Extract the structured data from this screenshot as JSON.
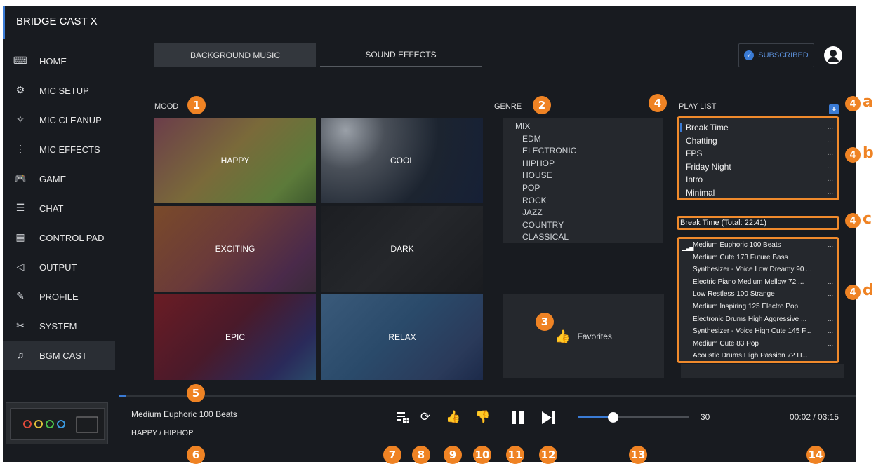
{
  "app": {
    "title": "BRIDGE CAST X"
  },
  "sidebar": {
    "items": [
      {
        "label": "HOME",
        "icon": "keyboard-icon",
        "glyph": "⌨"
      },
      {
        "label": "MIC SETUP",
        "icon": "mic-setup-icon",
        "glyph": "⚙"
      },
      {
        "label": "MIC CLEANUP",
        "icon": "mic-cleanup-icon",
        "glyph": "✧"
      },
      {
        "label": "MIC EFFECTS",
        "icon": "mic-effects-icon",
        "glyph": "⋮"
      },
      {
        "label": "GAME",
        "icon": "gamepad-icon",
        "glyph": "🎮"
      },
      {
        "label": "CHAT",
        "icon": "chat-icon",
        "glyph": "☰"
      },
      {
        "label": "CONTROL PAD",
        "icon": "grid-icon",
        "glyph": "▦"
      },
      {
        "label": "OUTPUT",
        "icon": "speaker-icon",
        "glyph": "◁"
      },
      {
        "label": "PROFILE",
        "icon": "profile-icon",
        "glyph": "✎"
      },
      {
        "label": "SYSTEM",
        "icon": "tools-icon",
        "glyph": "✂"
      },
      {
        "label": "BGM CAST",
        "icon": "music-note-icon",
        "glyph": "♫"
      }
    ]
  },
  "tabs": {
    "background_music": "BACKGROUND MUSIC",
    "sound_effects": "SOUND EFFECTS"
  },
  "header": {
    "subscribed": "SUBSCRIBED"
  },
  "mood": {
    "label": "MOOD",
    "items": [
      {
        "label": "HAPPY",
        "bg": "linear-gradient(135deg,#6b3d4a 0%,#7a6a3a 45%,#5c7a3a 80%,#3e5a2e 100%)"
      },
      {
        "label": "COOL",
        "bg": "radial-gradient(circle at 15% 15%,#9aa0a8 0%,#4a5059 25%,#1c2430 60%,#162036 100%)"
      },
      {
        "label": "EXCITING",
        "bg": "linear-gradient(135deg,#7a4a2a 0%,#6a3a3a 45%,#4a2a4a 80%,#3a2a3a 100%)"
      },
      {
        "label": "DARK",
        "bg": "linear-gradient(135deg,#1c1e22 0%,#25272b 50%,#1a1c20 100%)"
      },
      {
        "label": "EPIC",
        "bg": "linear-gradient(135deg,#6a1c24 0%,#4a1a2a 45%,#2a2a5a 80%,#2a4a6a 100%)"
      },
      {
        "label": "RELAX",
        "bg": "linear-gradient(135deg,#3a5a7a 0%,#2a4a6a 45%,#2a3a5a 80%,#1c2a4a 100%)"
      }
    ]
  },
  "genre": {
    "label": "GENRE",
    "items": [
      "MIX",
      "EDM",
      "ELECTRONIC",
      "HIPHOP",
      "HOUSE",
      "POP",
      "ROCK",
      "JAZZ",
      "COUNTRY",
      "CLASSICAL"
    ]
  },
  "favorites": {
    "label": "Favorites"
  },
  "playlist": {
    "label": "PLAY LIST",
    "items": [
      "Break Time",
      "Chatting",
      "FPS",
      "Friday Night",
      "Intro",
      "Minimal"
    ],
    "dots": "...",
    "total": "Break Time (Total: 22:41)",
    "tracks": [
      "Medium Euphoric 100 Beats",
      "Medium Cute 173 Future Bass",
      "Synthesizer - Voice Low Dreamy 90 ...",
      "Electric Piano Medium Mellow 72 ...",
      "Low Restless 100 Strange",
      "Medium Inspiring 125 Electro Pop",
      "Electronic Drums High Aggressive ...",
      "Synthesizer - Voice High Cute 145 F...",
      "Medium Cute 83 Pop",
      "Acoustic Drums High Passion 72 H..."
    ]
  },
  "player": {
    "title": "Medium Euphoric 100 Beats",
    "sub": "HAPPY / HIPHOP",
    "volume": "30",
    "volume_level": 0.3,
    "time": "00:02 / 03:15",
    "progress": 0.01
  },
  "badges": {
    "n1": "1",
    "n2": "2",
    "n3": "3",
    "n4": "4",
    "n5": "5",
    "n6": "6",
    "n7": "7",
    "n8": "8",
    "n9": "9",
    "n10": "10",
    "n11": "11",
    "n12": "12",
    "n13": "13",
    "n14": "14",
    "a": "a",
    "b": "b",
    "c": "c",
    "d": "d"
  },
  "colors": {
    "accent": "#3a7bd5",
    "badge": "#ef8324",
    "bg": "#181b20"
  }
}
